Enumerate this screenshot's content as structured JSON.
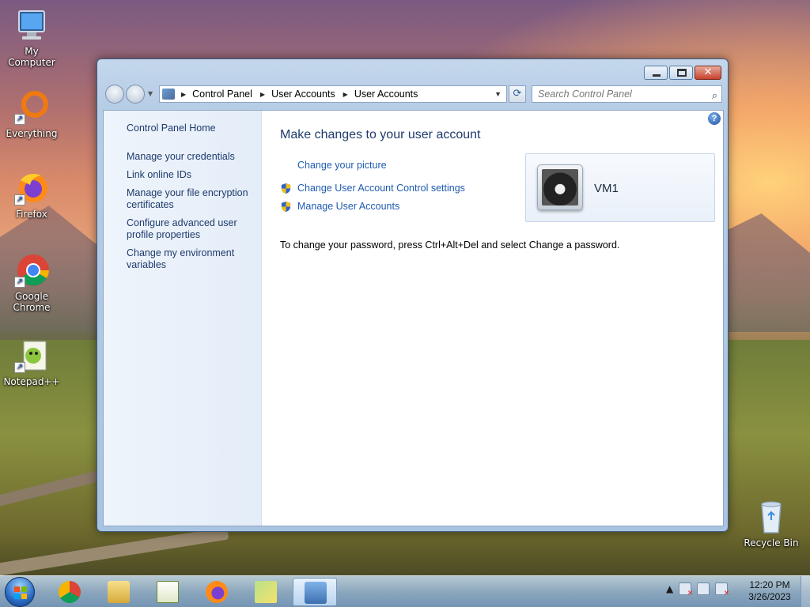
{
  "desktop": {
    "icons": [
      {
        "label": "My Computer"
      },
      {
        "label": "Everything"
      },
      {
        "label": "Firefox"
      },
      {
        "label": "Google Chrome"
      },
      {
        "label": "Notepad++"
      },
      {
        "label": "Recycle Bin"
      }
    ]
  },
  "window": {
    "breadcrumb": [
      "Control Panel",
      "User Accounts",
      "User Accounts"
    ],
    "search_placeholder": "Search Control Panel",
    "sidebar": {
      "home": "Control Panel Home",
      "links": [
        "Manage your credentials",
        "Link online IDs",
        "Manage your file encryption certificates",
        "Configure advanced user profile properties",
        "Change my environment variables"
      ]
    },
    "main": {
      "title": "Make changes to your user account",
      "tasks": [
        {
          "label": "Change your picture",
          "shield": false
        },
        {
          "label": "Change User Account Control settings",
          "shield": true
        },
        {
          "label": "Manage User Accounts",
          "shield": true
        }
      ],
      "user_name": "VM1",
      "password_note": "To change your password, press Ctrl+Alt+Del and select Change a password."
    }
  },
  "taskbar": {
    "apps": [
      "chrome-icon",
      "file-explorer-icon",
      "notepad-plus-plus-icon",
      "firefox-icon",
      "sticky-notes-icon",
      "control-panel-icon"
    ],
    "clock_time": "12:20 PM",
    "clock_date": "3/26/2023"
  },
  "colors": {
    "link": "#1f5bb0",
    "heading": "#1e3a6c",
    "taskbar": "#9cb8da"
  }
}
